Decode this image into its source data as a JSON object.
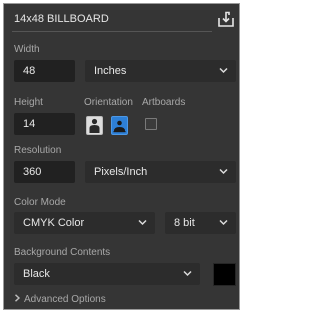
{
  "preset": {
    "title": "14x48 BILLBOARD",
    "save_icon": "save-preset-icon"
  },
  "width": {
    "label": "Width",
    "value": "48",
    "unit": "Inches"
  },
  "height": {
    "label": "Height",
    "value": "14"
  },
  "orientation": {
    "label": "Orientation",
    "selected": "landscape",
    "portrait_icon": "portrait-icon",
    "landscape_icon": "landscape-icon"
  },
  "artboards": {
    "label": "Artboards",
    "checked": false
  },
  "resolution": {
    "label": "Resolution",
    "value": "360",
    "unit": "Pixels/Inch"
  },
  "color_mode": {
    "label": "Color Mode",
    "mode": "CMYK Color",
    "depth": "8 bit"
  },
  "background": {
    "label": "Background Contents",
    "value": "Black",
    "swatch_color": "#000000"
  },
  "advanced": {
    "label": "Advanced Options"
  },
  "colors": {
    "panel": "#353535",
    "field": "#212121",
    "accent": "#2d7fd6"
  }
}
